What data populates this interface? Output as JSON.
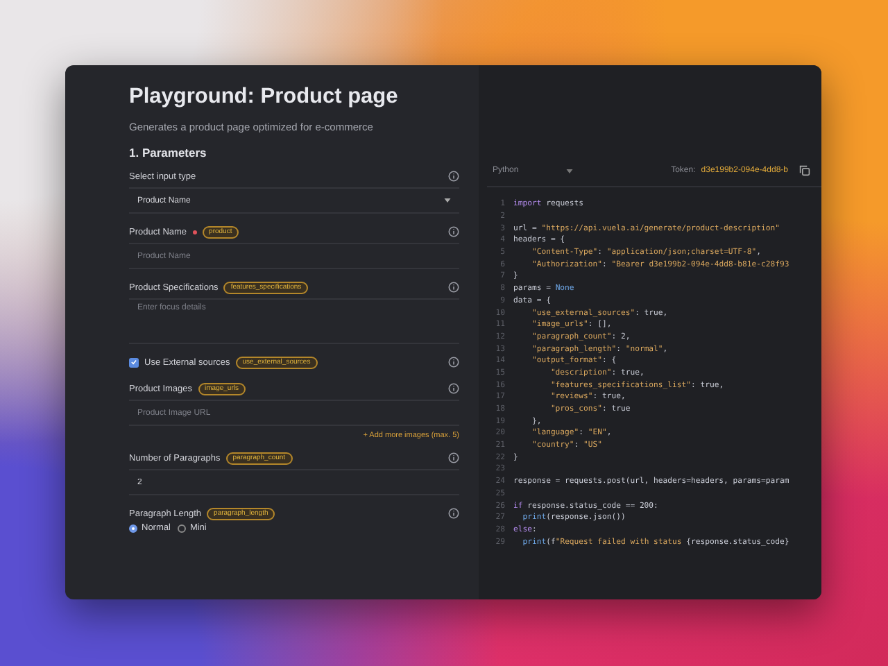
{
  "header": {
    "title": "Playground: Product page",
    "subtitle": "Generates a product page optimized for e-commerce",
    "section": "1. Parameters"
  },
  "fields": [
    {
      "kind": "select",
      "label": "Select input type",
      "value": "Product Name"
    },
    {
      "kind": "text",
      "label": "Product Name",
      "required": true,
      "badge": "product",
      "placeholder": "Product Name"
    },
    {
      "kind": "textarea",
      "label": "Product Specifications",
      "badge": "features_specifications",
      "placeholder": "Enter focus details"
    },
    {
      "kind": "checkbox",
      "label": "Use External sources",
      "badge": "use_external_sources",
      "checked": true
    },
    {
      "kind": "text",
      "label": "Product Images",
      "badge": "image_urls",
      "placeholder": "Product Image URL",
      "link": "+ Add more images (max. 5)"
    },
    {
      "kind": "text",
      "label": "Number of Paragraphs",
      "badge": "paragraph_count",
      "value": "2"
    },
    {
      "kind": "radio",
      "label": "Paragraph Length",
      "badge": "paragraph_length",
      "options": [
        {
          "label": "Normal",
          "selected": true
        },
        {
          "label": "Mini",
          "selected": false
        }
      ]
    }
  ],
  "code": {
    "language": "Python",
    "token_label": "Token:",
    "token": "d3e199b2-094e-4dd8-b",
    "lines": [
      {
        "n": "1",
        "tokens": [
          {
            "kind": "keyword",
            "text": "import"
          },
          {
            "kind": "plain",
            "text": " requests"
          }
        ]
      },
      {
        "n": "2"
      },
      {
        "n": "3",
        "tokens": [
          {
            "kind": "plain",
            "text": "url = "
          },
          {
            "kind": "string",
            "text": "\"https://api.vuela.ai/generate/product-description\""
          }
        ]
      },
      {
        "n": "4",
        "tokens": [
          {
            "kind": "plain",
            "text": "headers = {"
          }
        ]
      },
      {
        "n": "5",
        "tokens": [
          {
            "kind": "string",
            "text": "    \"Content-Type\""
          },
          {
            "kind": "plain",
            "text": ": "
          },
          {
            "kind": "string",
            "text": "\"application/json;charset=UTF-8\""
          },
          {
            "kind": "plain",
            "text": ","
          }
        ]
      },
      {
        "n": "6",
        "tokens": [
          {
            "kind": "string",
            "text": "    \"Authorization\""
          },
          {
            "kind": "plain",
            "text": ": "
          },
          {
            "kind": "string",
            "text": "\"Bearer d3e199b2-094e-4dd8-b81e-c28f93"
          }
        ]
      },
      {
        "n": "7",
        "tokens": [
          {
            "kind": "plain",
            "text": "}"
          }
        ]
      },
      {
        "n": "8",
        "tokens": [
          {
            "kind": "plain",
            "text": "params = "
          },
          {
            "kind": "constant",
            "text": "None"
          }
        ]
      },
      {
        "n": "9",
        "tokens": [
          {
            "kind": "plain",
            "text": "data = {"
          }
        ]
      },
      {
        "n": "10",
        "tokens": [
          {
            "kind": "string",
            "text": "    \"use_external_sources\""
          },
          {
            "kind": "plain",
            "text": ": true,"
          }
        ]
      },
      {
        "n": "11",
        "tokens": [
          {
            "kind": "string",
            "text": "    \"image_urls\""
          },
          {
            "kind": "plain",
            "text": ": [],"
          }
        ]
      },
      {
        "n": "12",
        "tokens": [
          {
            "kind": "string",
            "text": "    \"paragraph_count\""
          },
          {
            "kind": "plain",
            "text": ": 2,"
          }
        ]
      },
      {
        "n": "13",
        "tokens": [
          {
            "kind": "string",
            "text": "    \"paragraph_length\""
          },
          {
            "kind": "plain",
            "text": ": "
          },
          {
            "kind": "string",
            "text": "\"normal\""
          },
          {
            "kind": "plain",
            "text": ","
          }
        ]
      },
      {
        "n": "14",
        "tokens": [
          {
            "kind": "string",
            "text": "    \"output_format\""
          },
          {
            "kind": "plain",
            "text": ": {"
          }
        ]
      },
      {
        "n": "15",
        "tokens": [
          {
            "kind": "string",
            "text": "        \"description\""
          },
          {
            "kind": "plain",
            "text": ": true,"
          }
        ]
      },
      {
        "n": "16",
        "tokens": [
          {
            "kind": "string",
            "text": "        \"features_specifications_list\""
          },
          {
            "kind": "plain",
            "text": ": true,"
          }
        ]
      },
      {
        "n": "17",
        "tokens": [
          {
            "kind": "string",
            "text": "        \"reviews\""
          },
          {
            "kind": "plain",
            "text": ": true,"
          }
        ]
      },
      {
        "n": "18",
        "tokens": [
          {
            "kind": "string",
            "text": "        \"pros_cons\""
          },
          {
            "kind": "plain",
            "text": ": true"
          }
        ]
      },
      {
        "n": "19",
        "tokens": [
          {
            "kind": "plain",
            "text": "    },"
          }
        ]
      },
      {
        "n": "20",
        "tokens": [
          {
            "kind": "string",
            "text": "    \"language\""
          },
          {
            "kind": "plain",
            "text": ": "
          },
          {
            "kind": "string",
            "text": "\"EN\""
          },
          {
            "kind": "plain",
            "text": ","
          }
        ]
      },
      {
        "n": "21",
        "tokens": [
          {
            "kind": "string",
            "text": "    \"country\""
          },
          {
            "kind": "plain",
            "text": ": "
          },
          {
            "kind": "string",
            "text": "\"US\""
          }
        ]
      },
      {
        "n": "22",
        "tokens": [
          {
            "kind": "plain",
            "text": "}"
          }
        ]
      },
      {
        "n": "23"
      },
      {
        "n": "24",
        "tokens": [
          {
            "kind": "plain",
            "text": "response = requests.post(url, headers=headers, params=param"
          }
        ]
      },
      {
        "n": "25"
      },
      {
        "n": "26",
        "tokens": [
          {
            "kind": "keyword",
            "text": "if"
          },
          {
            "kind": "plain",
            "text": " response.status_code == 200:"
          }
        ]
      },
      {
        "n": "27",
        "tokens": [
          {
            "kind": "constant",
            "text": "  print"
          },
          {
            "kind": "plain",
            "text": "(response.json())"
          }
        ]
      },
      {
        "n": "28",
        "tokens": [
          {
            "kind": "keyword",
            "text": "else"
          },
          {
            "kind": "plain",
            "text": ":"
          }
        ]
      },
      {
        "n": "29",
        "tokens": [
          {
            "kind": "constant",
            "text": "  print"
          },
          {
            "kind": "plain",
            "text": "(f"
          },
          {
            "kind": "string",
            "text": "\"Request failed with status "
          },
          {
            "kind": "plain",
            "text": "{response.status_code}"
          }
        ]
      }
    ]
  }
}
